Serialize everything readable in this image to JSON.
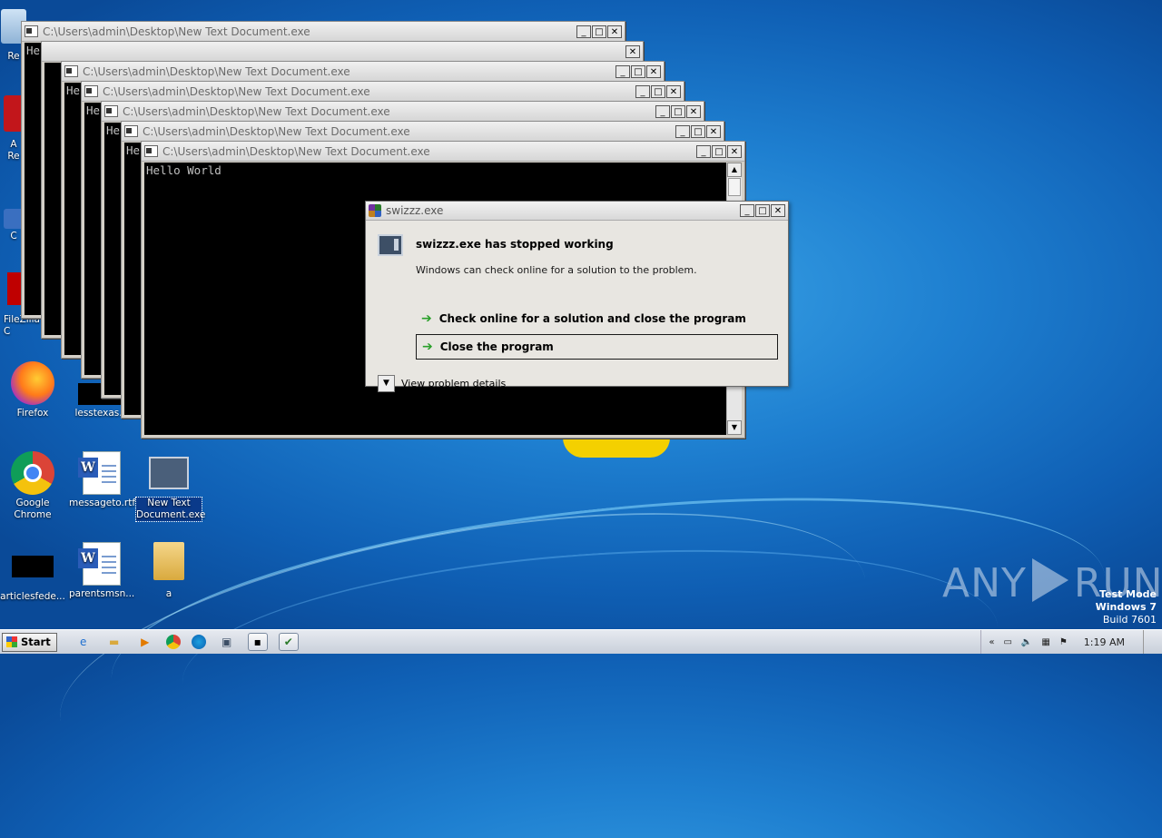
{
  "console": {
    "title": "C:\\Users\\admin\\Desktop\\New Text Document.exe",
    "output": "Hello World",
    "output_clipped": "He",
    "btn_min": "_",
    "btn_max": "□",
    "btn_close": "✕"
  },
  "dialog": {
    "title": "swizzz.exe",
    "heading": "swizzz.exe has stopped working",
    "message": "Windows can check online for a solution to the problem.",
    "option_check": "Check online for a solution and close the program",
    "option_close": "Close the program",
    "details": "View problem details",
    "arrow_icon": "green-arrow-icon"
  },
  "desktop": {
    "icons": {
      "firefox": "Firefox",
      "lesstexas": "lesstexas.j",
      "chrome": "Google Chrome",
      "messageto": "messageto.rtf",
      "newtextdoc": "New Text Document.exe",
      "articles": "articlesfede...",
      "parents": "parentsmsn...",
      "folder_a": "a",
      "filezilla": "FileZilla C"
    },
    "partial_labels": [
      "Re",
      "A",
      "Re",
      "C"
    ]
  },
  "watermark": {
    "left": "ANY",
    "right": "RUN"
  },
  "test_mode": {
    "line1": "Test Mode",
    "line2": "Windows 7",
    "line3": "Build 7601"
  },
  "taskbar": {
    "start_label": "Start",
    "clock": "1:19 AM",
    "tray_chevron": "«"
  }
}
